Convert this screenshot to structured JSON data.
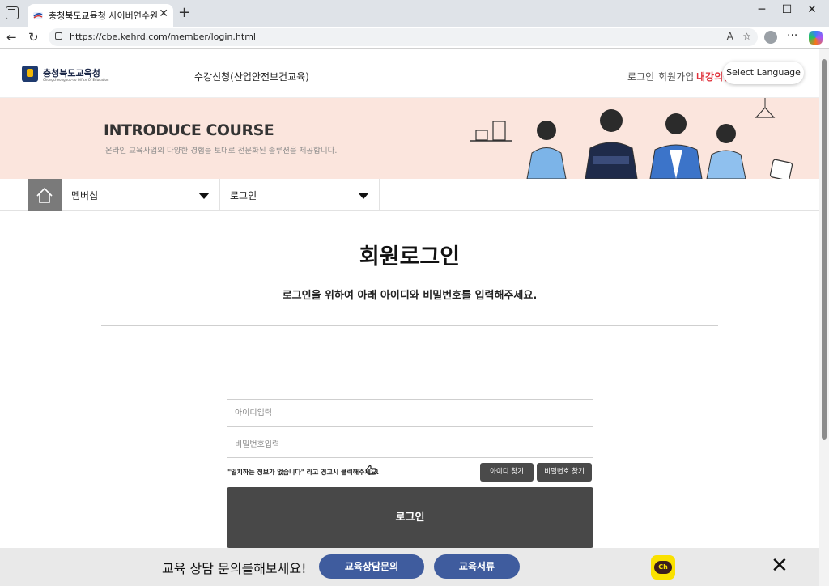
{
  "browser": {
    "tab_title": "충청북도교육청 사이버연수원",
    "url": "https://cbe.kehrd.com/member/login.html",
    "icons": [
      "tab-actions-icon",
      "close-icon",
      "plus-icon",
      "minimize-icon",
      "maximize-icon",
      "close-window-icon",
      "back-icon",
      "refresh-icon",
      "lock-icon",
      "read-aloud-icon",
      "favorite-star-icon",
      "profile-icon",
      "more-icon",
      "copilot-icon"
    ]
  },
  "header": {
    "logo_text": "충청북도교육청",
    "logo_sub": "Chungcheongbuk-do Office Of Education",
    "gnb_link": "수강신청(산업안전보건교육)",
    "util_login": "로그인",
    "util_join": "회원가입",
    "util_room": "내강의실",
    "lang_button": "Select Language"
  },
  "banner": {
    "title": "INTRODUCE COURSE",
    "subtitle": "온라인 교육사업의 다양한 경험을 토대로 전문화된 솔루션을 제공합니다."
  },
  "locnav": {
    "home_icon": "home-icon",
    "depth1": "멤버십",
    "depth2": "로그인"
  },
  "login": {
    "title": "회원로그인",
    "description": "로그인을 위하여 아래 아이디와 비밀번호를 입력해주세요.",
    "id_placeholder": "아이디입력",
    "pw_placeholder": "비밀번호입력",
    "hint": "\"일치하는 정보가 없습니다\" 라고 경고시 클릭해주세요.",
    "find_id": "아이디 찾기",
    "find_pw": "비밀번호 찾기",
    "submit": "로그인"
  },
  "consult": {
    "text": "교육 상담 문의를해보세요!",
    "btn_consult": "교육상담문의",
    "btn_docs": "교육서류",
    "kakao_label": "Ch"
  },
  "colors": {
    "banner_bg": "#fbe5dd",
    "accent_red": "#e0313b",
    "button_dark": "#484848",
    "consult_blue": "#3f5c9e",
    "kakao_yellow": "#fae100"
  }
}
